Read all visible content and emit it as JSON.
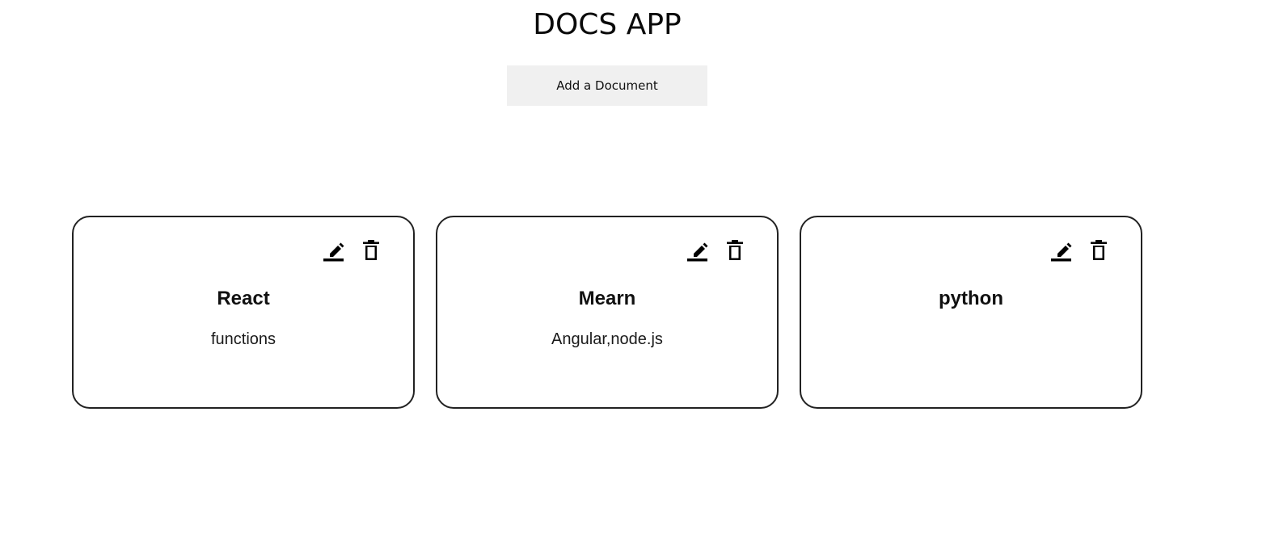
{
  "app": {
    "title": "DOCS APP",
    "add_button_label": "Add a Document"
  },
  "documents": [
    {
      "title": "React",
      "description": "functions",
      "actions": [
        "edit-icon",
        "delete-icon"
      ]
    },
    {
      "title": "Mearn",
      "description": "Angular,node.js",
      "actions": [
        "edit-icon",
        "delete-icon"
      ]
    },
    {
      "title": "python",
      "description": "",
      "actions": [
        "edit-icon",
        "delete-icon"
      ]
    }
  ],
  "colors": {
    "background": "#ffffff",
    "text": "#111111",
    "button_background": "#f0f0f0",
    "card_border": "#222222"
  }
}
